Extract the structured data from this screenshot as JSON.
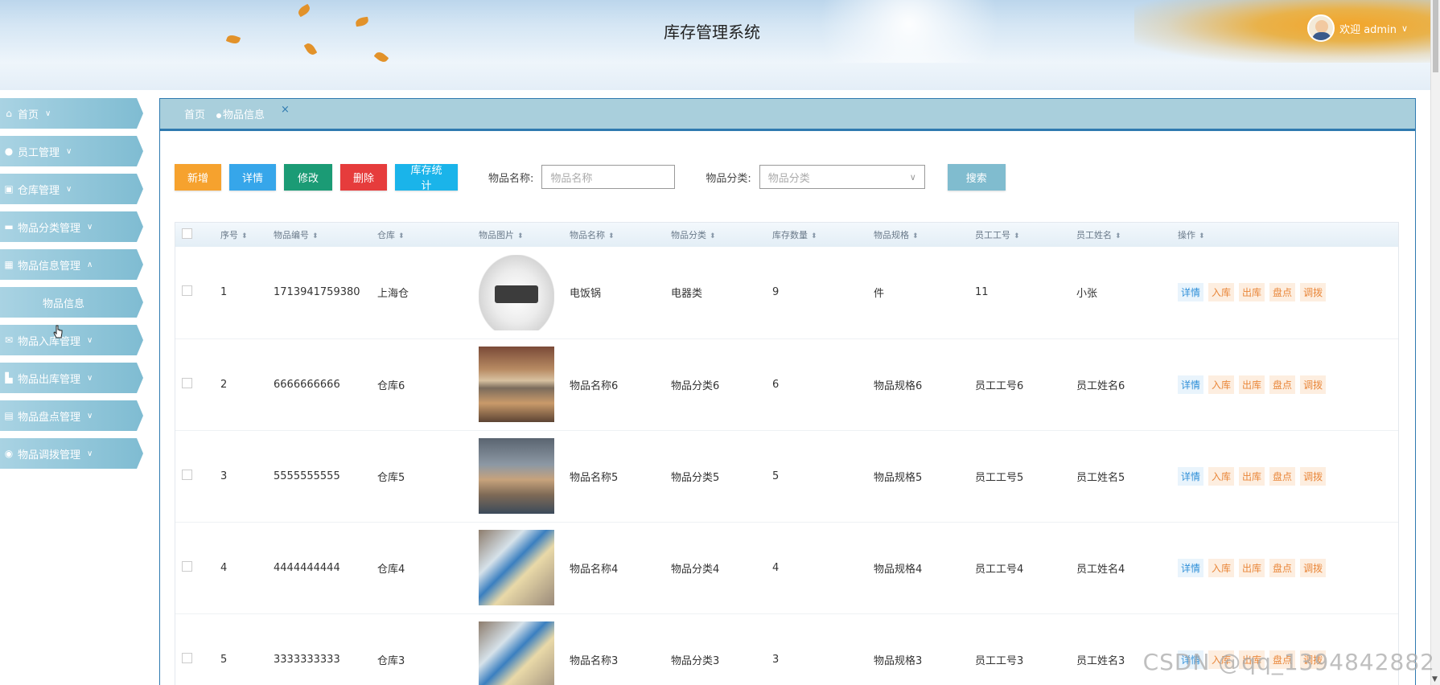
{
  "app": {
    "title": "库存管理系统",
    "user_greeting": "欢迎 admin"
  },
  "sidebar": {
    "items": [
      {
        "label": "首页",
        "icon": "home-icon",
        "caret": "∨"
      },
      {
        "label": "员工管理",
        "icon": "user-icon",
        "caret": "∨"
      },
      {
        "label": "仓库管理",
        "icon": "warehouse-icon",
        "caret": "∨"
      },
      {
        "label": "物品分类管理",
        "icon": "category-icon",
        "caret": "∨"
      },
      {
        "label": "物品信息管理",
        "icon": "grid-icon",
        "caret": "∧"
      },
      {
        "label": "物品信息",
        "icon": "",
        "caret": ""
      },
      {
        "label": "物品入库管理",
        "icon": "envelope-icon",
        "caret": "∨"
      },
      {
        "label": "物品出库管理",
        "icon": "export-icon",
        "caret": "∨"
      },
      {
        "label": "物品盘点管理",
        "icon": "inventory-icon",
        "caret": "∨"
      },
      {
        "label": "物品调拨管理",
        "icon": "transfer-icon",
        "caret": "∨"
      }
    ]
  },
  "tabs": {
    "home": "首页",
    "active": "物品信息",
    "close": "×"
  },
  "toolbar": {
    "add": "新增",
    "detail": "详情",
    "edit": "修改",
    "delete": "删除",
    "stats": "库存统计",
    "name_label": "物品名称:",
    "name_placeholder": "物品名称",
    "category_label": "物品分类:",
    "category_placeholder": "物品分类",
    "search": "搜索"
  },
  "table": {
    "columns": [
      "序号",
      "物品编号",
      "仓库",
      "物品图片",
      "物品名称",
      "物品分类",
      "库存数量",
      "物品规格",
      "员工工号",
      "员工姓名",
      "操作"
    ],
    "actions": [
      "详情",
      "入库",
      "出库",
      "盘点",
      "调拨"
    ],
    "rows": [
      {
        "no": "1",
        "code": "1713941759380",
        "warehouse": "上海仓",
        "image": "rice-cooker",
        "name": "电饭锅",
        "category": "电器类",
        "qty": "9",
        "spec": "件",
        "emp_id": "11",
        "emp_name": "小张"
      },
      {
        "no": "2",
        "code": "6666666666",
        "warehouse": "仓库6",
        "image": "cargo-center",
        "name": "物品名称6",
        "category": "物品分类6",
        "qty": "6",
        "spec": "物品规格6",
        "emp_id": "员工工号6",
        "emp_name": "员工姓名6"
      },
      {
        "no": "3",
        "code": "5555555555",
        "warehouse": "仓库5",
        "image": "truck-boxes",
        "name": "物品名称5",
        "category": "物品分类5",
        "qty": "5",
        "spec": "物品规格5",
        "emp_id": "员工工号5",
        "emp_name": "员工姓名5"
      },
      {
        "no": "4",
        "code": "4444444444",
        "warehouse": "仓库4",
        "image": "packages",
        "name": "物品名称4",
        "category": "物品分类4",
        "qty": "4",
        "spec": "物品规格4",
        "emp_id": "员工工号4",
        "emp_name": "员工姓名4"
      },
      {
        "no": "5",
        "code": "3333333333",
        "warehouse": "仓库3",
        "image": "packages",
        "name": "物品名称3",
        "category": "物品分类3",
        "qty": "3",
        "spec": "物品规格3",
        "emp_id": "员工工号3",
        "emp_name": "员工姓名3"
      }
    ]
  },
  "watermark": "CSDN @qq_1394842882",
  "colors": {
    "accent": "#2f7ab0",
    "menu": "#7fbcd2",
    "add": "#f6a22e",
    "detail": "#36a6ea",
    "edit": "#1b9b75",
    "delete": "#e63c3c",
    "stats": "#1ab4ea",
    "search": "#80bccf"
  }
}
